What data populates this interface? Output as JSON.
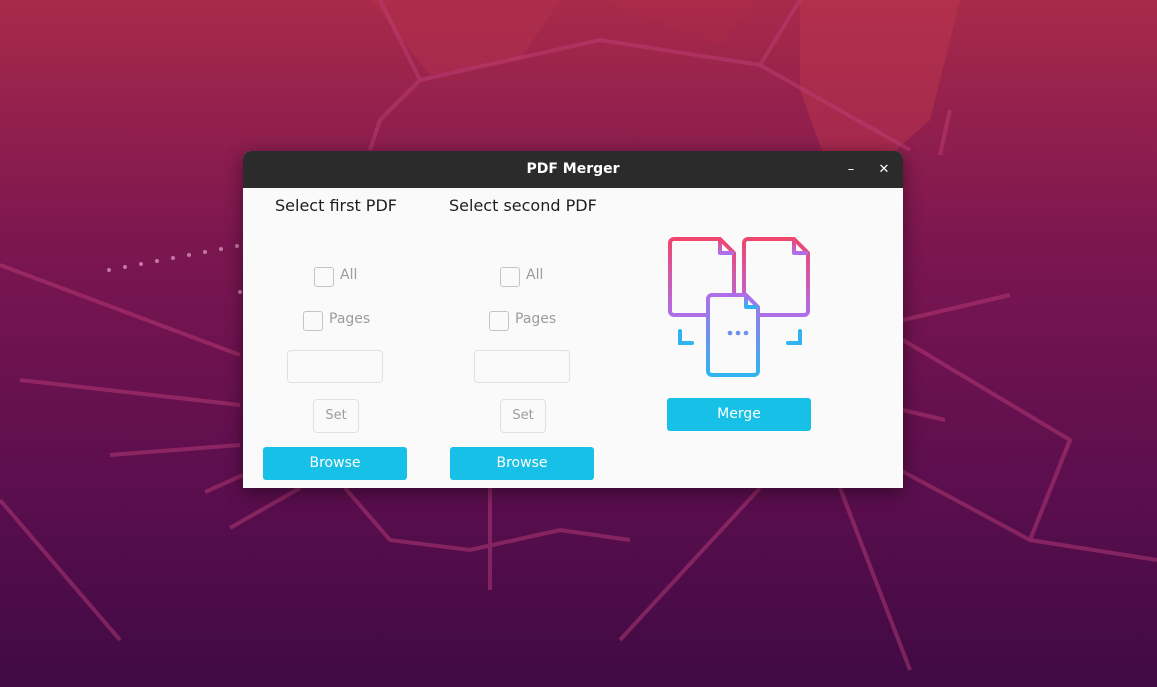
{
  "window": {
    "title": "PDF Merger",
    "minimize_icon": "minimize-icon",
    "close_icon": "close-icon",
    "minimize_glyph": "–",
    "close_glyph": "✕"
  },
  "first": {
    "heading": "Select first PDF",
    "all_label": "All",
    "pages_label": "Pages",
    "pages_value": "",
    "set_label": "Set",
    "browse_label": "Browse"
  },
  "second": {
    "heading": "Select second PDF",
    "all_label": "All",
    "pages_label": "Pages",
    "pages_value": "",
    "set_label": "Set",
    "browse_label": "Browse"
  },
  "merge": {
    "label": "Merge",
    "illustration_icon": "merge-documents-icon"
  },
  "colors": {
    "accent": "#17c0e6",
    "titlebar": "#2b2b2b",
    "window_bg": "#fafafa",
    "illustration_pink": "#f0466e",
    "illustration_purple": "#b06ee8",
    "illustration_blue": "#2fb4f0"
  }
}
